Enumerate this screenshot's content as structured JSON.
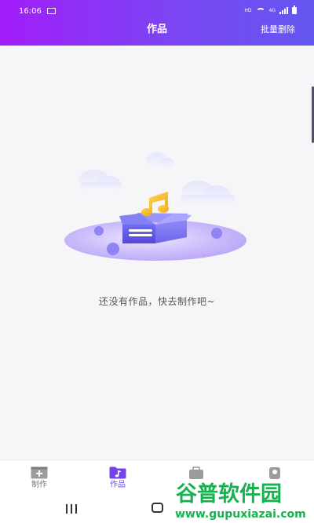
{
  "status_bar": {
    "time": "16:06",
    "indicators": "HD",
    "network": "4G"
  },
  "header": {
    "title": "作品",
    "batch_delete": "批量删除"
  },
  "empty_state": {
    "icon": "empty-box-music-note-illustration",
    "message": "还没有作品，快去制作吧~"
  },
  "bottom_nav": {
    "items": [
      {
        "label": "制作",
        "icon": "plus-window-icon",
        "active": false
      },
      {
        "label": "作品",
        "icon": "music-folder-icon",
        "active": true
      },
      {
        "label": "",
        "icon": "bag-icon",
        "active": false
      },
      {
        "label": "",
        "icon": "profile-icon",
        "active": false
      }
    ]
  },
  "watermark": {
    "brand": "谷普软件园",
    "url": "www.gupuxiazai.com"
  },
  "colors": {
    "header_gradient_start": "#a21dfa",
    "header_gradient_end": "#6357f0",
    "accent": "#6a4cf0",
    "watermark_green": "#16b24f"
  }
}
